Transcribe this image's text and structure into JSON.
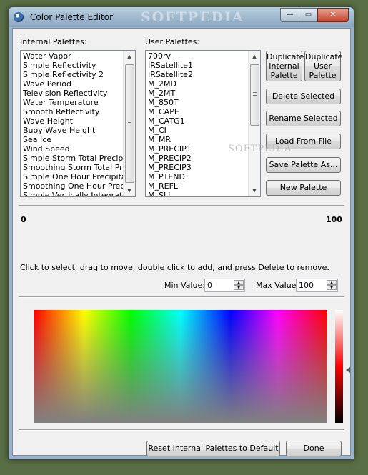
{
  "window": {
    "title": "Color Palette Editor",
    "watermark": "SOFTPEDIA",
    "minimize_glyph": "—",
    "maximize_glyph": "▭",
    "close_glyph": "✕"
  },
  "internal": {
    "label": "Internal Palettes:",
    "items": [
      "Water Vapor",
      "Simple Reflectivity",
      "Simple Reflectivity 2",
      "Wave Period",
      "Television Reflectivity",
      "Water Temperature",
      "Smooth Reflectivity",
      "Wave Height",
      "Buoy Wave Height",
      "Sea Ice",
      "Wind Speed",
      "Simple Storm Total Precipitati",
      "Smoothing Storm Total Precip",
      "Simple One Hour Precipitation",
      "Smoothing One Hour Precipit",
      "Simple Vertically Integrated L"
    ]
  },
  "user": {
    "label": "User Palettes:",
    "items": [
      "700rv",
      "IRSatellite1",
      "IRSatellite2",
      "M_2MD",
      "M_2MT",
      "M_850T",
      "M_CAPE",
      "M_CATG1",
      "M_CI",
      "M_MR",
      "M_PRECIP1",
      "M_PRECIP2",
      "M_PRECIP3",
      "M_PTEND",
      "M_REFL",
      "M_SLI"
    ]
  },
  "buttons": {
    "duplicate_internal": "Duplicate\nInternal\nPalette",
    "duplicate_user": "Duplicate\nUser\nPalette",
    "delete_selected": "Delete Selected",
    "rename_selected": "Rename Selected",
    "load_from_file": "Load From File",
    "save_palette_as": "Save Palette As...",
    "new_palette": "New Palette",
    "reset_internal": "Reset Internal Palettes to Default",
    "done": "Done"
  },
  "scale": {
    "min_label": "0",
    "max_label": "100"
  },
  "instructions": "Click to select, drag to move, double click to add, and press Delete to remove.",
  "min_value": {
    "label": "Min Value:",
    "value": "0"
  },
  "max_value": {
    "label": "Max Value:",
    "value": "100"
  },
  "watermark_mid": "SOFTPEDIA",
  "colors": {
    "window_frame": "#9bb3c9",
    "client_bg": "#f0f0f0",
    "close_button": "#c2432b"
  }
}
